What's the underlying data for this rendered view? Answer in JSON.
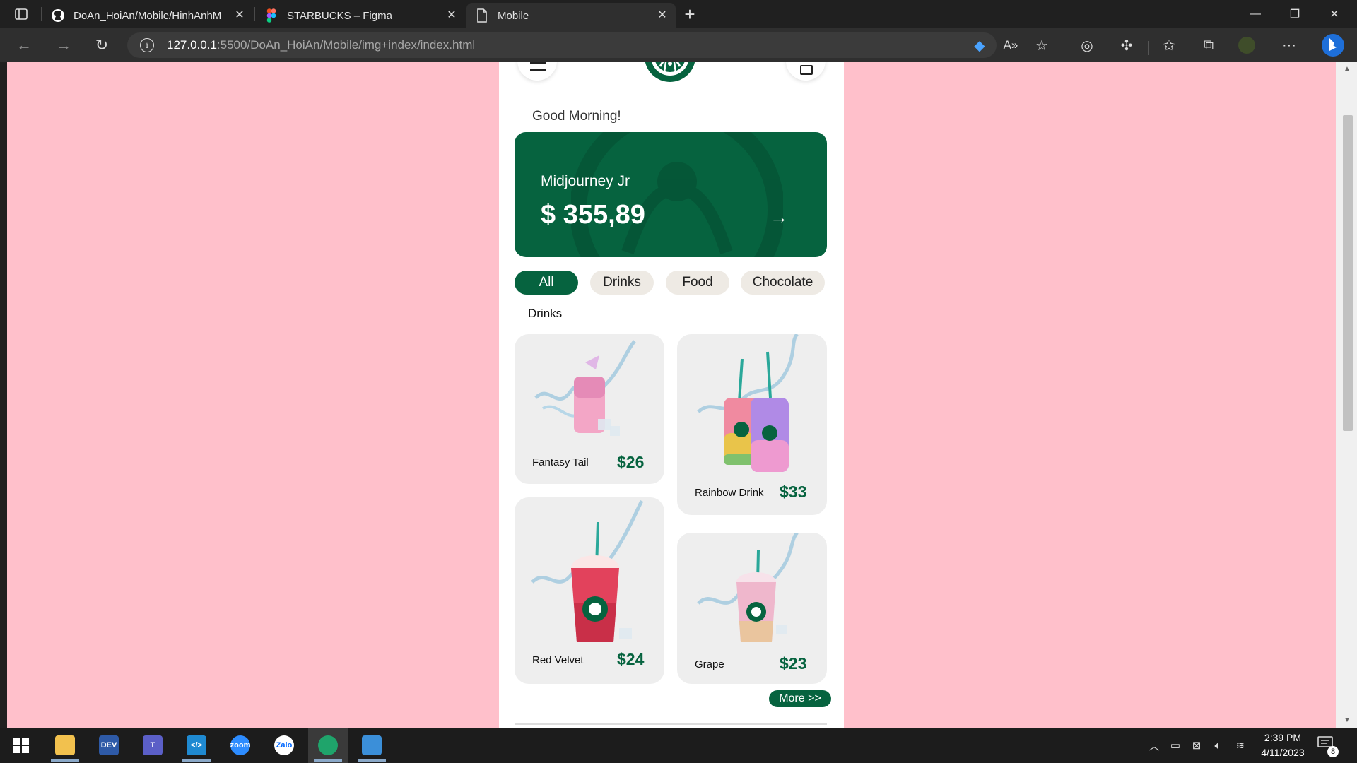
{
  "browser": {
    "tabs": [
      {
        "title": "DoAn_HoiAn/Mobile/HinhAnhM",
        "icon": "github-icon"
      },
      {
        "title": "STARBUCKS – Figma",
        "icon": "figma-icon"
      },
      {
        "title": "Mobile",
        "icon": "document-icon"
      }
    ],
    "url_host": "127.0.0.1",
    "url_path": ":5500/DoAn_HoiAn/Mobile/img+index/index.html"
  },
  "app": {
    "greeting": "Good Morning!",
    "card": {
      "name": "Midjourney Jr",
      "balance": "$ 355,89"
    },
    "categories": [
      "All",
      "Drinks",
      "Food",
      "Chocolate"
    ],
    "active_category": "All",
    "section_title": "Drinks",
    "products": [
      {
        "name": "Fantasy Tail",
        "price": "$26"
      },
      {
        "name": "Rainbow Drink",
        "price": "$33"
      },
      {
        "name": "Red Velvet",
        "price": "$24"
      },
      {
        "name": "Grape",
        "price": "$23"
      }
    ],
    "more_label": "More >>",
    "brand_color": "#06633f",
    "page_background": "#ffc0cb"
  },
  "taskbar": {
    "apps": [
      "start-icon",
      "file-explorer-icon",
      "dev-icon",
      "teams-icon",
      "vscode-icon",
      "zoom-icon",
      "zalo-icon",
      "edge-icon",
      "photos-icon"
    ],
    "time": "2:39 PM",
    "date": "4/11/2023",
    "notification_count": "8"
  }
}
